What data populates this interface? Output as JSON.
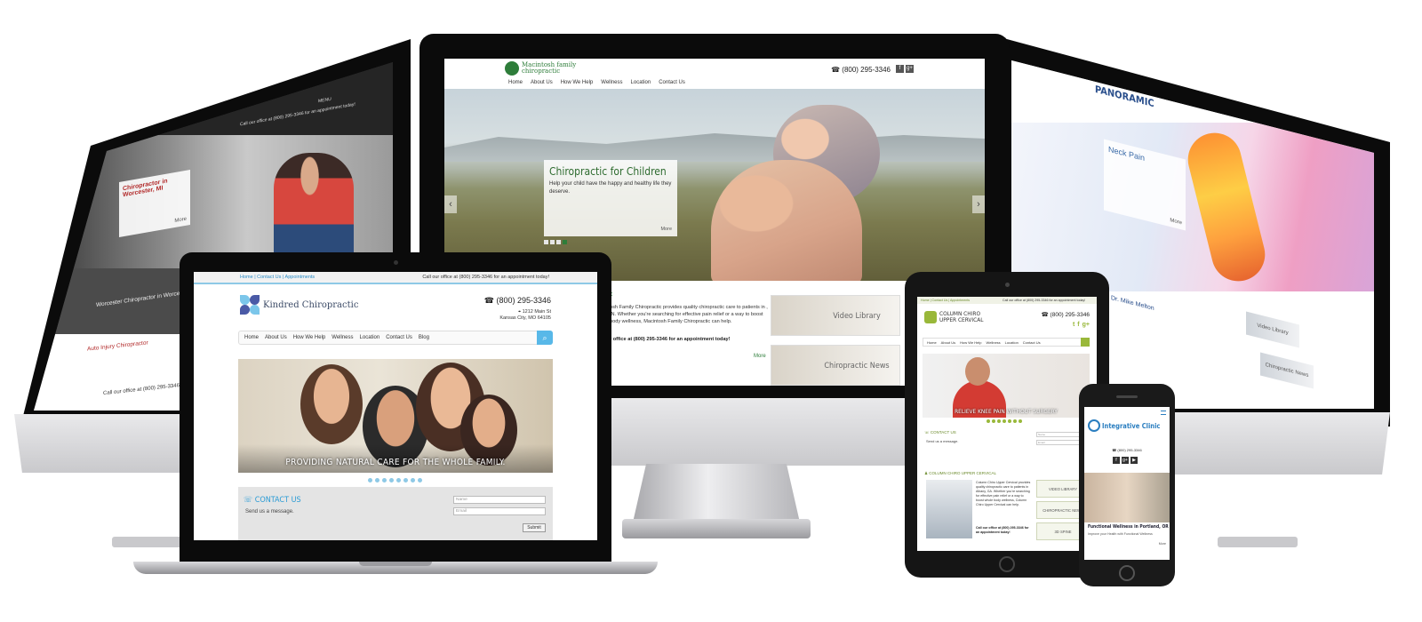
{
  "center_site": {
    "logo_line1": "Macintosh family",
    "logo_line2": "chiropractic",
    "phone": "(800) 295-3346",
    "social": [
      "f",
      "g+"
    ],
    "nav": [
      "Home",
      "About Us",
      "How We Help",
      "Wellness",
      "Location",
      "Contact Us"
    ],
    "slide_title": "Chiropractic for Children",
    "slide_text": "Help your child have the happy and healthy life they deserve.",
    "slide_more": "More",
    "body_heading_fragment": "c",
    "body_text": "osh Family Chiropractic provides quality chiropractic care to patients in , IN. Whether you're searching for effective pain relief or a way to boost body wellness, Macintosh Family Chiropractic can help.",
    "body_call": "r office at (800) 295-3346 for an appointment today!",
    "body_more": "More",
    "tiles": [
      "Video Library",
      "Chiropractic News"
    ]
  },
  "laptop_site": {
    "top_links": "Home | Contact Us | Appointments",
    "top_call": "Call our office at (800) 295-3346 for an appointment today!",
    "logo": "Kindred Chiropractic",
    "phone": "(800) 295-3346",
    "address_line1": "1212 Main St",
    "address_line2": "Kansas City, MO 64105",
    "nav": [
      "Home",
      "About Us",
      "How We Help",
      "Wellness",
      "Location",
      "Contact Us",
      "Blog"
    ],
    "hero_caption": "PROVIDING NATURAL CARE FOR THE WHOLE FAMILY.",
    "contact_title": "CONTACT US",
    "contact_text": "Send us a message.",
    "name_placeholder": "Name",
    "email_placeholder": "Email",
    "submit": "Submit"
  },
  "tablet_site": {
    "top_links": "Home | Contact Us | Appointments",
    "top_call": "Call our office at (800) 295-3346 for an appointment today!",
    "logo_line1": "COLUMN CHIRO",
    "logo_line2": "UPPER CERVICAL",
    "phone": "(800) 295-3346",
    "social": [
      "t",
      "f",
      "g+"
    ],
    "nav": [
      "Home",
      "About Us",
      "How We Help",
      "Wellness",
      "Location",
      "Contact Us"
    ],
    "hero_caption": "RELIEVE KNEE PAIN WITHOUT SURGERY",
    "contact_title": "CONTACT US",
    "contact_text": "Send us a message.",
    "name_placeholder": "Name",
    "email_placeholder": "Email",
    "section_title": "COLUMN CHIRO UPPER CERVICAL",
    "section_text": "Column Chiro Upper Cervical provides quality chiropractic care to patients in Albany, GA. Whether you're searching for effective pain relief or a way to boost whole body wellness, Column Chiro Upper Cervical can help.",
    "section_call": "Call our office at (800) 295-3346 for an appointment today!",
    "tiles": [
      "VIDEO LIBRARY",
      "CHIROPRACTIC NEWS",
      "3D SPINE"
    ]
  },
  "phone_site": {
    "logo": "Integrative Clinic",
    "phone": "(800) 295-3346",
    "social": [
      "f",
      "g+",
      "▶"
    ],
    "slide_title": "Functional Wellness in Portland, OR",
    "slide_text": "Improve your Health with Functional Wellness",
    "slide_more": "More"
  },
  "left_site": {
    "top_call": "Call our office at (800) 295-3346 for an appointment today!",
    "menu": "MENU",
    "slide_title": "Chiropractor in Worcester, MI",
    "slide_more": "More",
    "band_title": "Worcester Chiropractor in Worcester, MI",
    "section_title": "Auto Injury Chiropractor",
    "section_call": "Call our office at (800) 295-3346 for an appointment today!"
  },
  "right_site": {
    "logo": "PANORAMIC",
    "slide_title": "Neck Pain",
    "slide_more": "More",
    "doctor": "Dr. Mike Melton",
    "tiles": [
      "Video Library",
      "Chiropractic News"
    ]
  }
}
